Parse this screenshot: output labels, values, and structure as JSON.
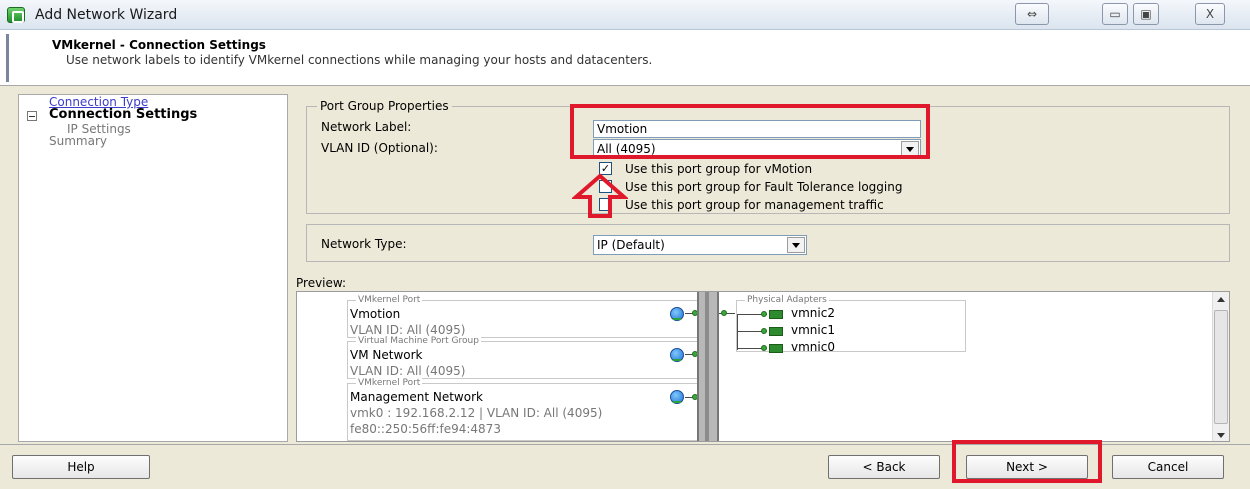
{
  "window": {
    "title": "Add Network Wizard",
    "buttons": {
      "swap": "⇔",
      "minimize": "▭",
      "maximize": "▣",
      "close": "X"
    }
  },
  "header": {
    "title": "VMkernel - Connection Settings",
    "subtitle": "Use network labels to identify VMkernel connections while managing your hosts and datacenters."
  },
  "nav": {
    "items": [
      {
        "label": "Connection Type"
      },
      {
        "label": "Connection Settings"
      },
      {
        "label": "IP Settings"
      },
      {
        "label": "Summary"
      }
    ]
  },
  "port_group_properties": {
    "legend": "Port Group Properties",
    "network_label_caption": "Network Label:",
    "network_label_value": "Vmotion",
    "vlan_caption": "VLAN ID (Optional):",
    "vlan_value": "All (4095)",
    "checkboxes": [
      {
        "label": "Use this port group for vMotion",
        "checked": true
      },
      {
        "label": "Use this port group for Fault Tolerance logging",
        "checked": false
      },
      {
        "label": "Use this port group for management traffic",
        "checked": false
      }
    ]
  },
  "network_type": {
    "caption": "Network Type:",
    "value": "IP (Default)"
  },
  "preview": {
    "label": "Preview:",
    "port_groups": [
      {
        "legend": "VMkernel Port",
        "name": "Vmotion",
        "details": [
          "VLAN ID: All (4095)"
        ]
      },
      {
        "legend": "Virtual Machine Port Group",
        "name": "VM Network",
        "details": [
          "VLAN ID: All (4095)"
        ]
      },
      {
        "legend": "VMkernel Port",
        "name": "Management Network",
        "details": [
          "vmk0 : 192.168.2.12 | VLAN ID: All (4095)",
          "fe80::250:56ff:fe94:4873"
        ]
      }
    ],
    "physical_adapters": {
      "legend": "Physical Adapters",
      "nics": [
        "vmnic2",
        "vmnic1",
        "vmnic0"
      ]
    }
  },
  "footer": {
    "help": "Help",
    "back": "< Back",
    "next": "Next >",
    "cancel": "Cancel"
  },
  "colors": {
    "annotation": "#e0182b",
    "link": "#3b3bcc",
    "background": "#ece9d8"
  }
}
